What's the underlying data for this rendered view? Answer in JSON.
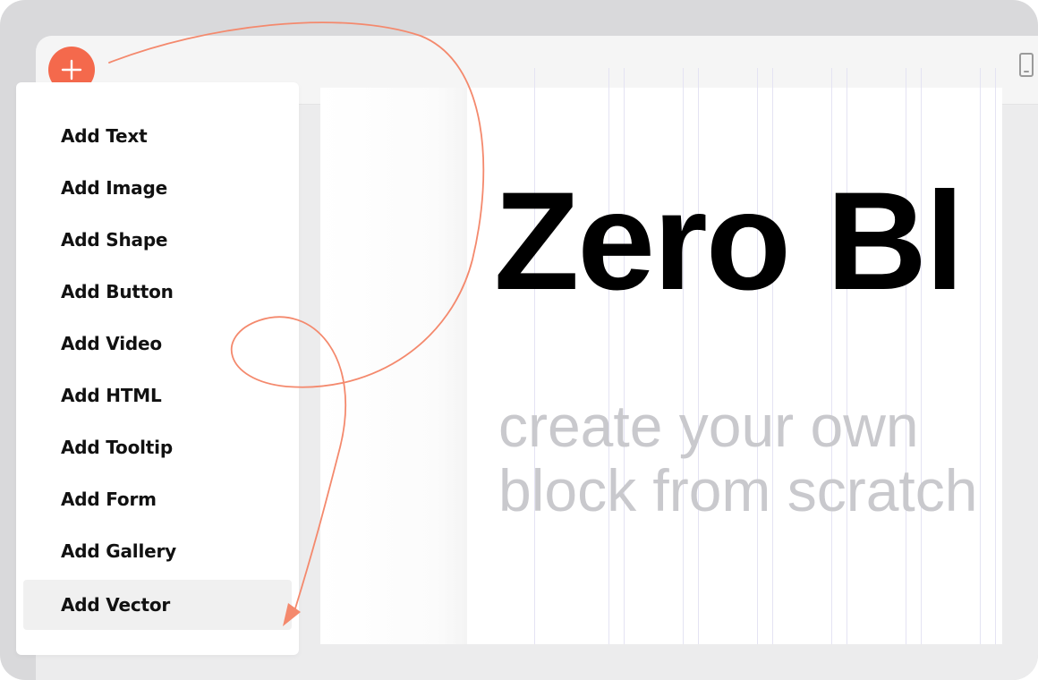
{
  "colors": {
    "accent": "#f4694c",
    "arrow": "#f4896d",
    "subtitle": "#c9c9cd",
    "gridline": "#e4e3f3"
  },
  "toolbar": {
    "add_icon": "plus-icon",
    "device_icon": "mobile-device-icon"
  },
  "menu": {
    "items": [
      {
        "label": "Add Text",
        "active": false
      },
      {
        "label": "Add Image",
        "active": false
      },
      {
        "label": "Add Shape",
        "active": false
      },
      {
        "label": "Add Button",
        "active": false
      },
      {
        "label": "Add Video",
        "active": false
      },
      {
        "label": "Add HTML",
        "active": false
      },
      {
        "label": "Add Tooltip",
        "active": false
      },
      {
        "label": "Add Form",
        "active": false
      },
      {
        "label": "Add Gallery",
        "active": false
      },
      {
        "label": "Add Vector",
        "active": true
      }
    ]
  },
  "canvas": {
    "title": "Zero Bl",
    "subtitle_line1": "create your own",
    "subtitle_line2": "block from scratch"
  }
}
